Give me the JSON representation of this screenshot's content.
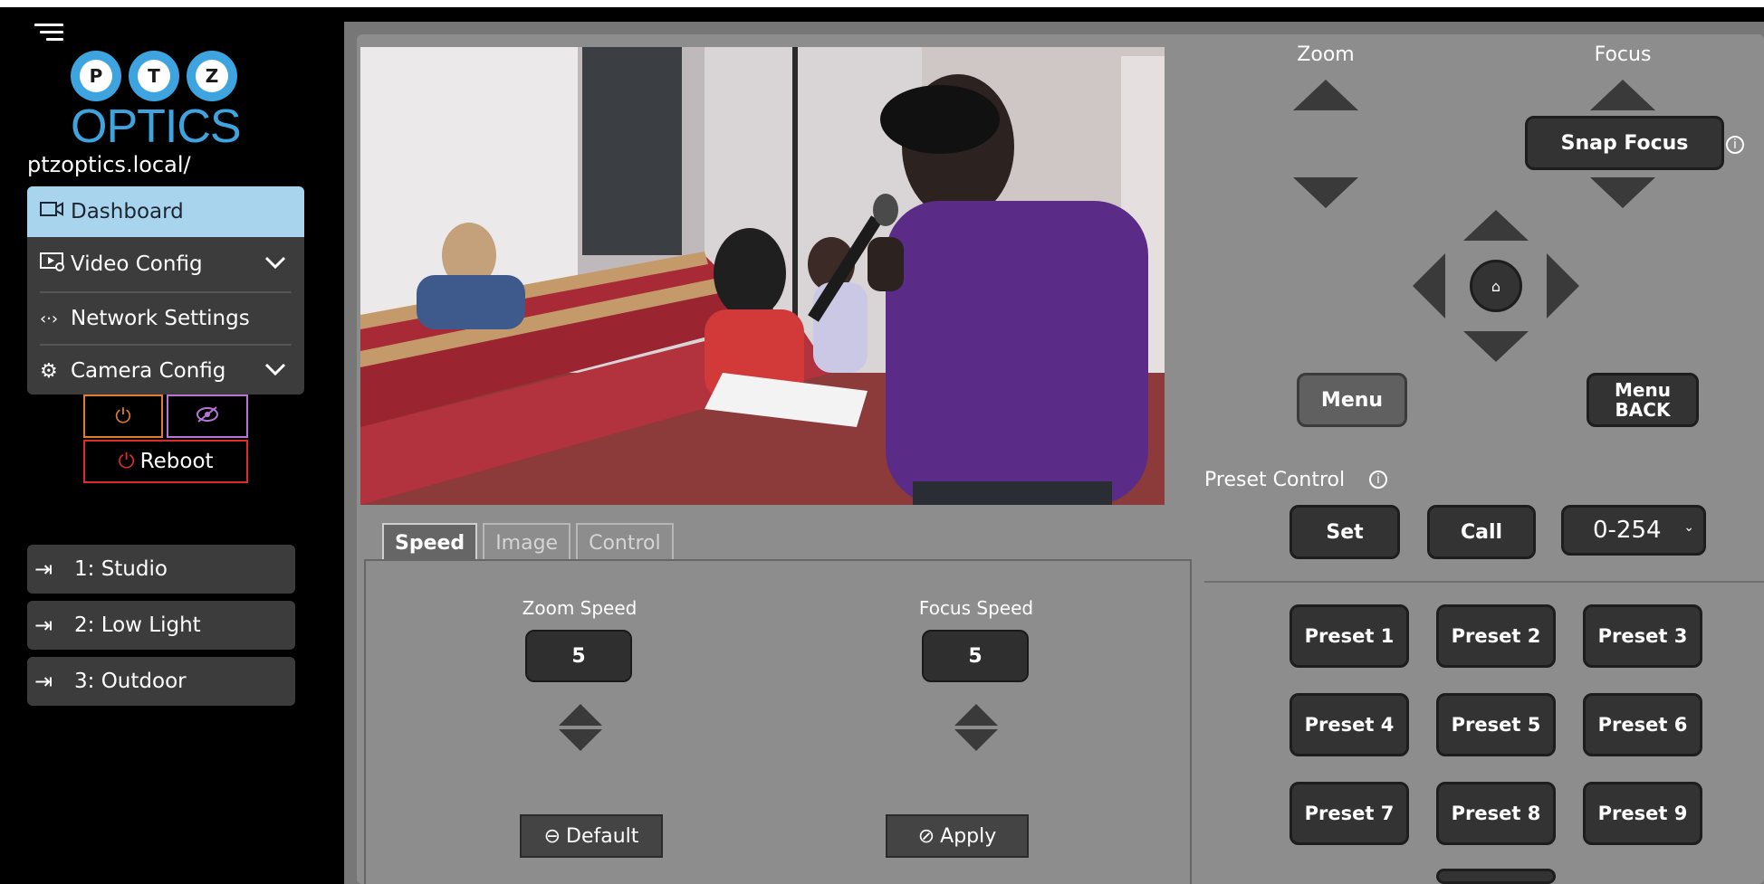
{
  "sidebar": {
    "logo_letters": [
      "P",
      "T",
      "Z"
    ],
    "logo_text": "OPTICS",
    "host": "ptzoptics.local/",
    "nav": [
      {
        "label": "Dashboard",
        "icon": "camera-icon"
      },
      {
        "label": "Video Config",
        "icon": "video-settings-icon"
      },
      {
        "label": "Network Settings",
        "icon": "network-icon"
      },
      {
        "label": "Camera Config",
        "icon": "gear-icon"
      }
    ],
    "reboot_label": "Reboot",
    "presets": [
      {
        "label": "1: Studio"
      },
      {
        "label": "2: Low Light"
      },
      {
        "label": "3: Outdoor"
      }
    ]
  },
  "tabs": [
    {
      "label": "Speed",
      "active": true
    },
    {
      "label": "Image",
      "active": false
    },
    {
      "label": "Control",
      "active": false
    }
  ],
  "speed": {
    "zoom_label": "Zoom Speed",
    "zoom_value": "5",
    "focus_label": "Focus Speed",
    "focus_value": "5",
    "default_label": "Default",
    "apply_label": "Apply"
  },
  "ptz": {
    "zoom_label": "Zoom",
    "focus_label": "Focus",
    "snap_focus_label": "Snap Focus",
    "menu_label": "Menu",
    "menu_back_label": "Menu BACK"
  },
  "preset_control": {
    "title": "Preset Control",
    "set_label": "Set",
    "call_label": "Call",
    "select_value": "0-254",
    "presets": [
      "Preset 1",
      "Preset 2",
      "Preset 3",
      "Preset 4",
      "Preset 5",
      "Preset 6",
      "Preset 7",
      "Preset 8",
      "Preset 9"
    ]
  },
  "colors": {
    "accent": "#3da4e0",
    "active_nav": "#a8d4ee",
    "power": "#e07d2e",
    "privacy": "#b576d6",
    "reboot": "#e02a2a"
  }
}
